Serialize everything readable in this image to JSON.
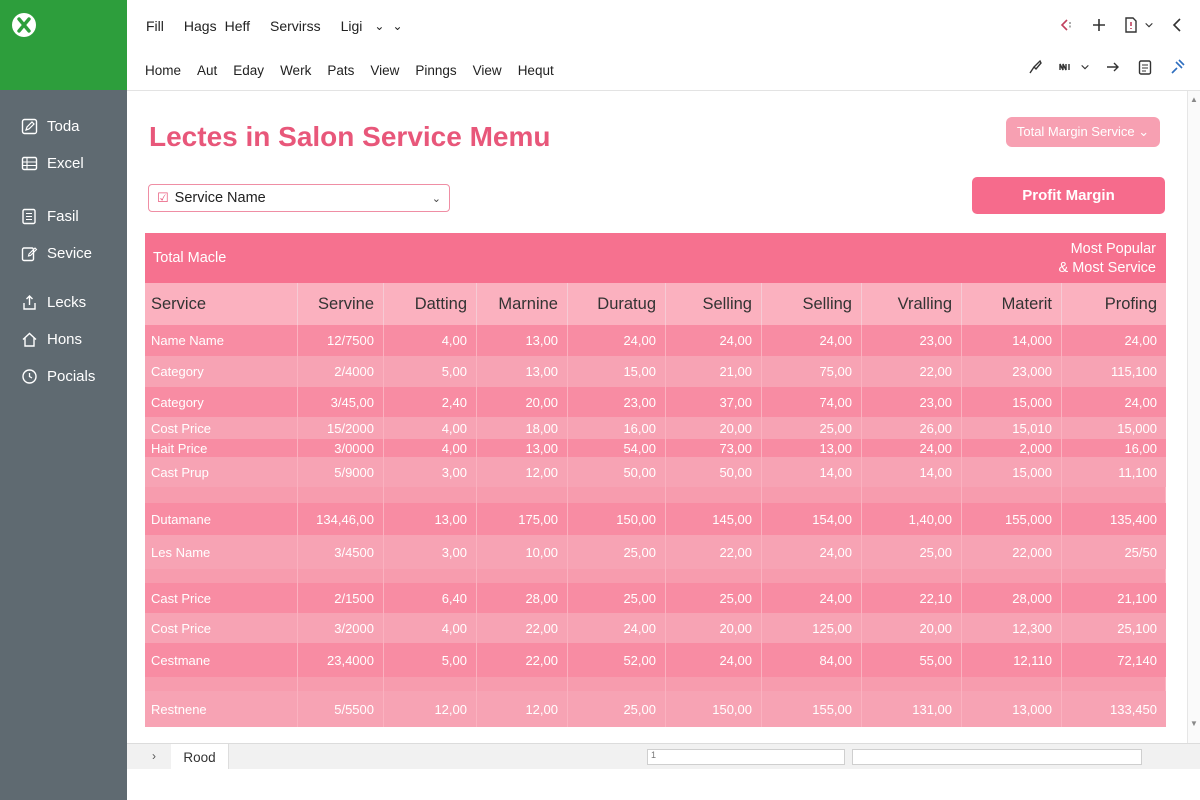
{
  "menu": {
    "items": [
      "Fill",
      "Hags",
      "Heff",
      "Servirss",
      "Ligi"
    ],
    "chevrons": [
      "⌄",
      "⌄"
    ]
  },
  "ribbon": {
    "tabs": [
      "Home",
      "Aut",
      "Eday",
      "Werk",
      "Pats",
      "View",
      "Pinngs",
      "View",
      "Hequt"
    ]
  },
  "sidebar": {
    "items": [
      {
        "label": "Toda",
        "icon": "pencil-square-icon"
      },
      {
        "label": "Excel",
        "icon": "grid-icon"
      },
      {
        "label": "Fasil",
        "icon": "document-lines-icon"
      },
      {
        "label": "Sevice",
        "icon": "edit-document-icon"
      },
      {
        "label": "Lecks",
        "icon": "share-icon"
      },
      {
        "label": "Hons",
        "icon": "home-icon"
      },
      {
        "label": "Pocials",
        "icon": "refresh-circle-icon"
      }
    ]
  },
  "page": {
    "title": "Lectes in Salon Service Memu",
    "top_button": "Total Margin Service ⌄",
    "select_value": "Service Name",
    "profit_button": "Profit Margin"
  },
  "table": {
    "banner_left": "Total Macle",
    "banner_right_1": "Most Popular",
    "banner_right_2": "& Most Service",
    "headers": [
      "Service",
      "Servine",
      "Datting",
      "Marnine",
      "Duratug",
      "Selling",
      "Selling",
      "Vralling",
      "Materit",
      "Profing"
    ],
    "rows": [
      [
        "Name Name",
        "12/7500",
        "4,00",
        "13,00",
        "24,00",
        "24,00",
        "24,00",
        "23,00",
        "14,000",
        "24,00"
      ],
      [
        "Category",
        "2/4000",
        "5,00",
        "13,00",
        "15,00",
        "21,00",
        "75,00",
        "22,00",
        "23,000",
        "115,100"
      ],
      [
        "Category",
        "3/45,00",
        "2,40",
        "20,00",
        "23,00",
        "37,00",
        "74,00",
        "23,00",
        "15,000",
        "24,00"
      ],
      [
        "Cost Price",
        "15/2000",
        "4,00",
        "18,00",
        "16,00",
        "20,00",
        "25,00",
        "26,00",
        "15,010",
        "15,000"
      ],
      [
        "Hait Price",
        "3/0000",
        "4,00",
        "13,00",
        "54,00",
        "73,00",
        "13,00",
        "24,00",
        "2,000",
        "16,00"
      ],
      [
        "Cast Prup",
        "5/9000",
        "3,00",
        "12,00",
        "50,00",
        "50,00",
        "14,00",
        "14,00",
        "15,000",
        "11,100"
      ],
      [
        "Dutamane",
        "134,46,00",
        "13,00",
        "175,00",
        "150,00",
        "145,00",
        "154,00",
        "1,40,00",
        "155,000",
        "135,400"
      ],
      [
        "Les Name",
        "3/4500",
        "3,00",
        "10,00",
        "25,00",
        "22,00",
        "24,00",
        "25,00",
        "22,000",
        "25/50"
      ],
      [
        "Cast Price",
        "2/1500",
        "6,40",
        "28,00",
        "25,00",
        "25,00",
        "24,00",
        "22,10",
        "28,000",
        "21,100"
      ],
      [
        "Cost Price",
        "3/2000",
        "4,00",
        "22,00",
        "24,00",
        "20,00",
        "125,00",
        "20,00",
        "12,300",
        "25,100"
      ],
      [
        "Cestmane",
        "23,4000",
        "5,00",
        "22,00",
        "52,00",
        "24,00",
        "84,00",
        "55,00",
        "12,110",
        "72,140"
      ],
      [
        "Restnene",
        "5/5500",
        "12,00",
        "12,00",
        "25,00",
        "150,00",
        "155,00",
        "131,00",
        "13,000",
        "133,450"
      ]
    ]
  },
  "sheetbar": {
    "nav": "›",
    "tab": "Rood",
    "field1": "1"
  },
  "colors": {
    "brand_green": "#2d9e3c",
    "sidebar": "#5f6a71",
    "accent_pink": "#e8577a",
    "table_pink": "#f98ca2"
  }
}
